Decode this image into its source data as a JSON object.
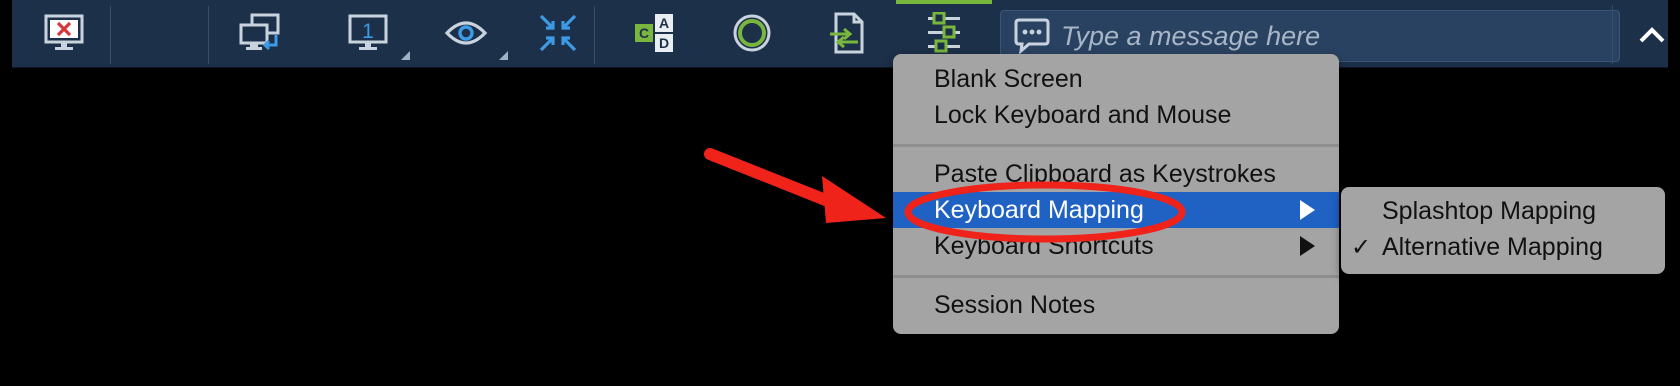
{
  "toolbar": {
    "buttons": [
      {
        "name": "disconnect",
        "icon": "monitor-x-icon"
      },
      {
        "name": "switch-computer",
        "icon": "monitors-arrow-icon"
      },
      {
        "name": "monitor-1",
        "icon": "monitor-1-icon",
        "badge": "1"
      },
      {
        "name": "view",
        "icon": "eye-icon"
      },
      {
        "name": "fit-screen",
        "icon": "compress-arrows-icon"
      },
      {
        "name": "ctrl-alt-del",
        "icon": "cad-keys-icon",
        "keys": [
          "C",
          "A",
          "D"
        ]
      },
      {
        "name": "record",
        "icon": "record-circle-icon"
      },
      {
        "name": "file-transfer",
        "icon": "file-transfer-icon"
      },
      {
        "name": "more-actions",
        "icon": "sliders-icon"
      }
    ],
    "message_placeholder": "Type a message here",
    "colors": {
      "bar": "#1d3049",
      "accent_green": "#79b63d",
      "accent_blue": "#3d9ae4",
      "danger": "#d8363b"
    }
  },
  "menu": {
    "items": [
      {
        "label": "Blank Screen"
      },
      {
        "label": "Lock Keyboard and Mouse"
      },
      {
        "label": "Paste Clipboard as Keystrokes"
      },
      {
        "label": "Keyboard Mapping",
        "highlighted": true,
        "submenu": true
      },
      {
        "label": "Keyboard Shortcuts",
        "submenu": true
      },
      {
        "label": "Session Notes"
      }
    ],
    "highlight_color": "#1f62c4"
  },
  "submenu": {
    "items": [
      {
        "label": "Splashtop Mapping",
        "checked": false
      },
      {
        "label": "Alternative Mapping",
        "checked": true,
        "check_mark": "✓"
      }
    ]
  },
  "annotations": {
    "arrow_color": "#f0231b",
    "ellipse_color": "#f0231b"
  }
}
